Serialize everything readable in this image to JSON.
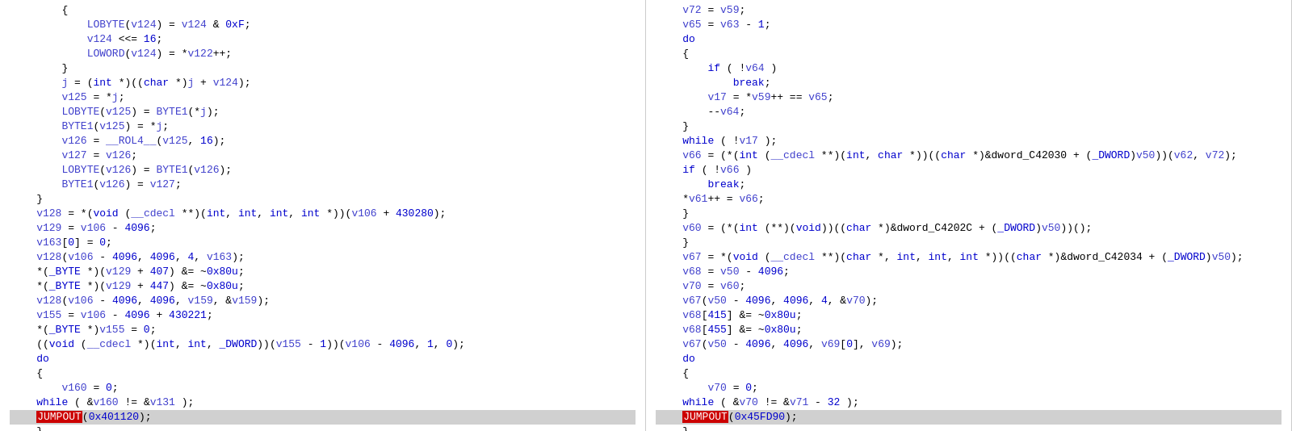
{
  "pane1": {
    "lines": [
      {
        "text": "        {",
        "highlight": false
      },
      {
        "text": "            LOBYTE(v124) = v124 & 0xF;",
        "highlight": false
      },
      {
        "text": "            v124 <<= 16;",
        "highlight": false
      },
      {
        "text": "            LOWORD(v124) = *v122++;",
        "highlight": false
      },
      {
        "text": "        }",
        "highlight": false
      },
      {
        "text": "        j = (int *)((char *)j + v124);",
        "highlight": false
      },
      {
        "text": "        v125 = *j;",
        "highlight": false
      },
      {
        "text": "        LOBYTE(v125) = BYTE1(*j);",
        "highlight": false
      },
      {
        "text": "        BYTE1(v125) = *j;",
        "highlight": false
      },
      {
        "text": "        v126 = __ROL4__(v125, 16);",
        "highlight": false
      },
      {
        "text": "        v127 = v126;",
        "highlight": false
      },
      {
        "text": "        LOBYTE(v126) = BYTE1(v126);",
        "highlight": false
      },
      {
        "text": "        BYTE1(v126) = v127;",
        "highlight": false
      },
      {
        "text": "    }",
        "highlight": false
      },
      {
        "text": "    v128 = *(void (__cdecl **)(int, int, int, int *))(v106 + 430280);",
        "highlight": false
      },
      {
        "text": "    v129 = v106 - 4096;",
        "highlight": false
      },
      {
        "text": "    v163[0] = 0;",
        "highlight": false
      },
      {
        "text": "    v128(v106 - 4096, 4096, 4, v163);",
        "highlight": false
      },
      {
        "text": "    *(_BYTE *)(v129 + 407) &= ~0x80u;",
        "highlight": false
      },
      {
        "text": "    *(_BYTE *)(v129 + 447) &= ~0x80u;",
        "highlight": false
      },
      {
        "text": "    v128(v106 - 4096, 4096, v159, &v159);",
        "highlight": false
      },
      {
        "text": "    v155 = v106 - 4096 + 430221;",
        "highlight": false
      },
      {
        "text": "    *(_BYTE *)v155 = 0;",
        "highlight": false
      },
      {
        "text": "    ((void (__cdecl *)(int, int, _DWORD))(v155 - 1))(v106 - 4096, 1, 0);",
        "highlight": false
      },
      {
        "text": "    do",
        "highlight": false
      },
      {
        "text": "    {",
        "highlight": false
      },
      {
        "text": "        v160 = 0;",
        "highlight": false
      },
      {
        "text": "    while ( &v160 != &v131 );",
        "highlight": false
      },
      {
        "text": "    JUMPOUT(0x401120);",
        "highlight": true,
        "has_macro": true,
        "macro_text": "JUMPOUT",
        "after_macro": "(0x401120);"
      },
      {
        "text": "    }",
        "highlight": false
      },
      {
        "text": "  }",
        "highlight": false
      },
      {
        "text": "}",
        "highlight": false
      }
    ]
  },
  "pane2": {
    "lines": [
      {
        "text": "    v72 = v59;",
        "highlight": false
      },
      {
        "text": "    v65 = v63 - 1;",
        "highlight": false
      },
      {
        "text": "    do",
        "highlight": false
      },
      {
        "text": "    {",
        "highlight": false
      },
      {
        "text": "        if ( !v64 )",
        "highlight": false
      },
      {
        "text": "            break;",
        "highlight": false
      },
      {
        "text": "        v17 = *v59++ == v65;",
        "highlight": false
      },
      {
        "text": "        --v64;",
        "highlight": false
      },
      {
        "text": "    }",
        "highlight": false
      },
      {
        "text": "    while ( !v17 );",
        "highlight": false
      },
      {
        "text": "    v66 = (*(int (__cdecl **)(int, char *))((char *)&dword_C42030 + (_DWORD)v50))(v62, v72);",
        "highlight": false
      },
      {
        "text": "    if ( !v66 )",
        "highlight": false
      },
      {
        "text": "        break;",
        "highlight": false
      },
      {
        "text": "    *v61++ = v66;",
        "highlight": false
      },
      {
        "text": "    }",
        "highlight": false
      },
      {
        "text": "    v60 = (*(int (**)(void))((char *)&dword_C4202C + (_DWORD)v50))();",
        "highlight": false
      },
      {
        "text": "    }",
        "highlight": false
      },
      {
        "text": "    v67 = *(void (__cdecl **)(char *, int, int, int *))((char *)&dword_C42034 + (_DWORD)v50);",
        "highlight": false
      },
      {
        "text": "    v68 = v50 - 4096;",
        "highlight": false
      },
      {
        "text": "    v70 = v60;",
        "highlight": false
      },
      {
        "text": "    v67(v50 - 4096, 4096, 4, &v70);",
        "highlight": false
      },
      {
        "text": "    v68[415] &= ~0x80u;",
        "highlight": false
      },
      {
        "text": "    v68[455] &= ~0x80u;",
        "highlight": false
      },
      {
        "text": "    v67(v50 - 4096, 4096, v69[0], v69);",
        "highlight": false
      },
      {
        "text": "    do",
        "highlight": false
      },
      {
        "text": "    {",
        "highlight": false
      },
      {
        "text": "        v70 = 0;",
        "highlight": false
      },
      {
        "text": "    while ( &v70 != &v71 - 32 );",
        "highlight": false
      },
      {
        "text": "    JUMPOUT(0x45FD90);",
        "highlight": true,
        "has_macro": true,
        "macro_text": "JUMPOUT",
        "after_macro": "(0x45FD90);"
      },
      {
        "text": "    }",
        "highlight": false
      },
      {
        "text": "  }",
        "highlight": false
      },
      {
        "text": "}",
        "highlight": false
      }
    ]
  }
}
